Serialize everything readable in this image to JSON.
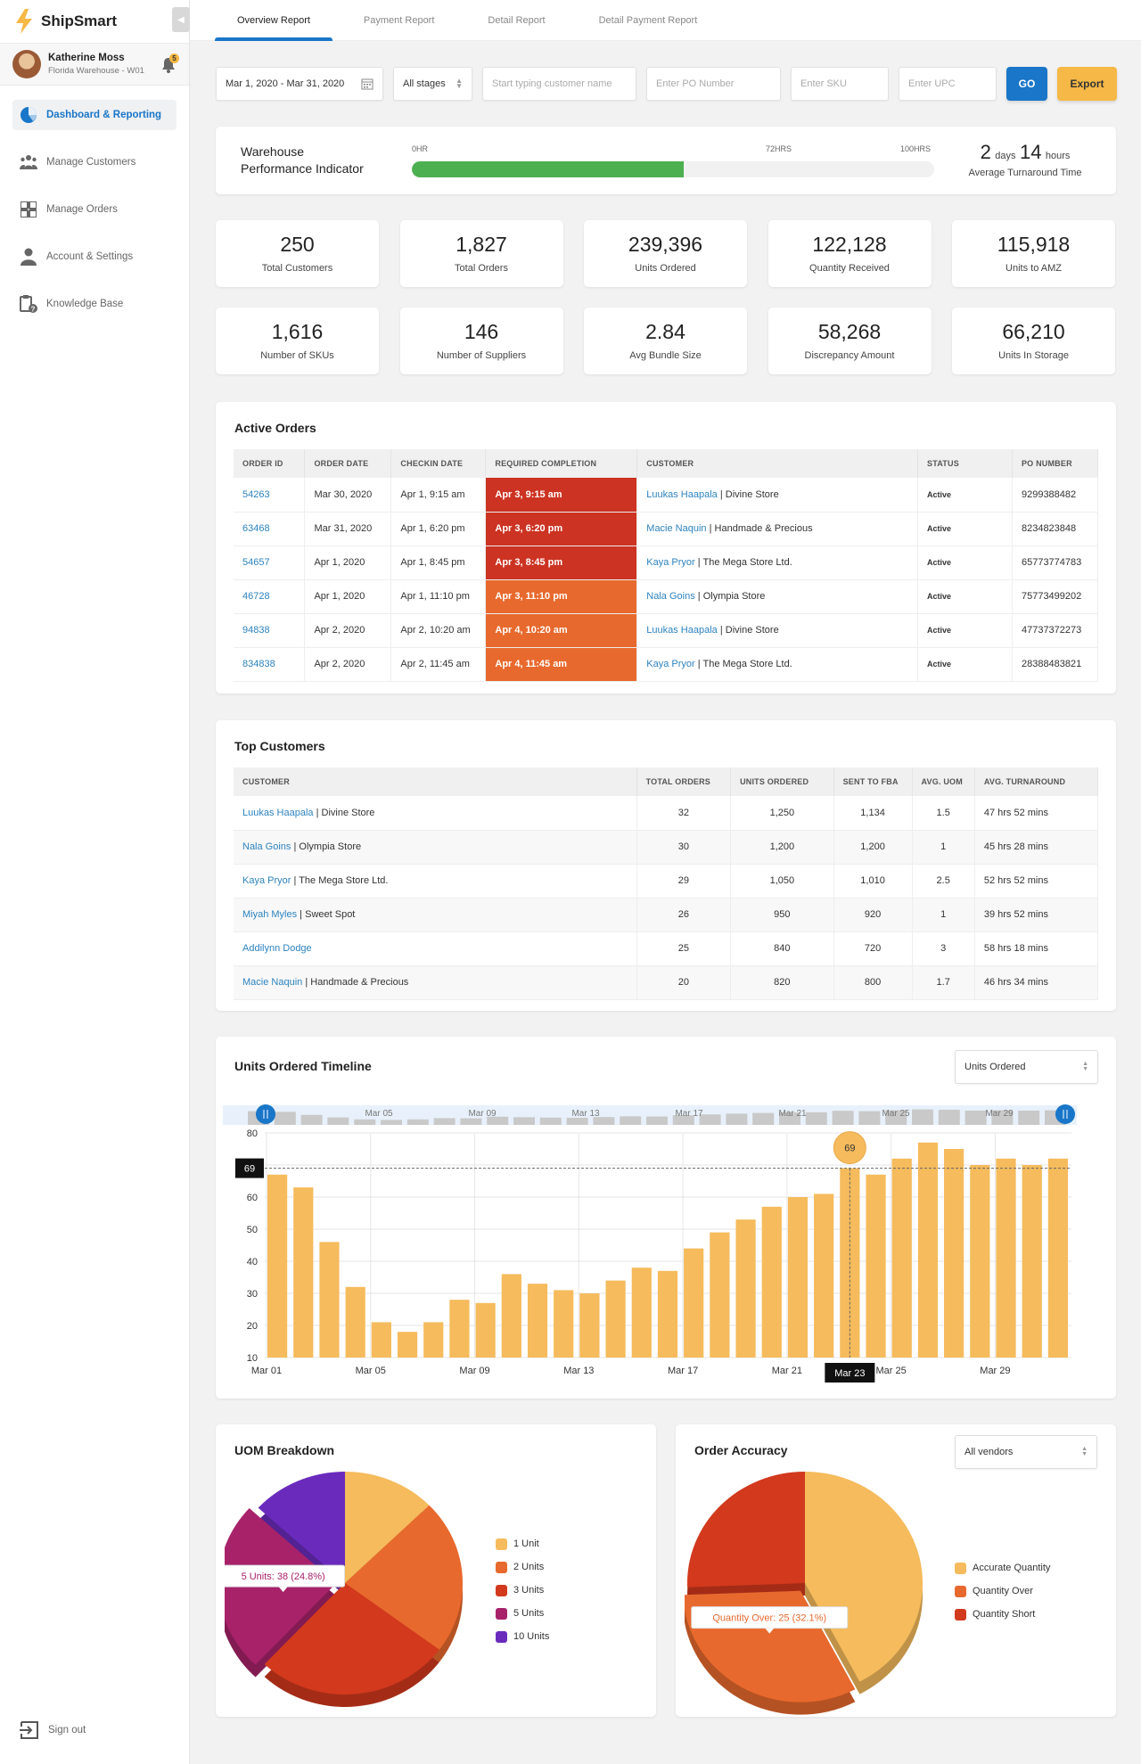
{
  "app": {
    "name": "ShipSmart"
  },
  "user": {
    "name": "Katherine Moss",
    "location": "Florida Warehouse - W01",
    "notifications": "5"
  },
  "sidebar": {
    "items": [
      {
        "label": "Dashboard & Reporting",
        "icon": "pie-chart-icon",
        "active": true
      },
      {
        "label": "Manage Customers",
        "icon": "users-icon"
      },
      {
        "label": "Manage Orders",
        "icon": "grid-icon"
      },
      {
        "label": "Account & Settings",
        "icon": "user-icon"
      },
      {
        "label": "Knowledge Base",
        "icon": "clipboard-help-icon"
      }
    ],
    "signout": "Sign out"
  },
  "tabs": [
    {
      "label": "Overview Report",
      "active": true
    },
    {
      "label": "Payment Report"
    },
    {
      "label": "Detail Report"
    },
    {
      "label": "Detail Payment Report"
    }
  ],
  "filters": {
    "date_range": "Mar 1, 2020 - Mar 31, 2020",
    "stage": "All stages",
    "customer_placeholder": "Start typing customer name",
    "po_placeholder": "Enter PO Number",
    "sku_placeholder": "Enter SKU",
    "upc_placeholder": "Enter UPC",
    "go": "GO",
    "export": "Export"
  },
  "wpi": {
    "title_line1": "Warehouse",
    "title_line2": "Performance Indicator",
    "label_start": "0HR",
    "label_mid": "72HRS",
    "label_end": "100HRS",
    "progress_percent": 52,
    "days": "2",
    "days_unit": "days",
    "hours": "14",
    "hours_unit": "hours",
    "subtitle": "Average Turnaround Time"
  },
  "stats": [
    {
      "value": "250",
      "label": "Total Customers"
    },
    {
      "value": "1,827",
      "label": "Total Orders"
    },
    {
      "value": "239,396",
      "label": "Units Ordered"
    },
    {
      "value": "122,128",
      "label": "Quantity Received"
    },
    {
      "value": "115,918",
      "label": "Units to AMZ"
    },
    {
      "value": "1,616",
      "label": "Number of SKUs"
    },
    {
      "value": "146",
      "label": "Number of Suppliers"
    },
    {
      "value": "2.84",
      "label": "Avg Bundle Size"
    },
    {
      "value": "58,268",
      "label": "Discrepancy Amount"
    },
    {
      "value": "66,210",
      "label": "Units In Storage"
    }
  ],
  "active_orders": {
    "title": "Active Orders",
    "columns": [
      "ORDER ID",
      "ORDER DATE",
      "CHECKIN DATE",
      "REQUIRED COMPLETION",
      "CUSTOMER",
      "STATUS",
      "PO NUMBER"
    ],
    "rows": [
      {
        "id": "54263",
        "order_date": "Mar 30, 2020",
        "checkin": "Apr 1, 9:15 am",
        "required": "Apr 3, 9:15 am",
        "urgency": "red",
        "customer": "Luukas Haapala",
        "store": "Divine Store",
        "status": "Active",
        "po": "9299388482"
      },
      {
        "id": "63468",
        "order_date": "Mar 31, 2020",
        "checkin": "Apr 1, 6:20 pm",
        "required": "Apr 3, 6:20 pm",
        "urgency": "red",
        "customer": "Macie Naquin",
        "store": "Handmade & Precious",
        "status": "Active",
        "po": "8234823848"
      },
      {
        "id": "54657",
        "order_date": "Apr 1, 2020",
        "checkin": "Apr 1, 8:45 pm",
        "required": "Apr 3, 8:45 pm",
        "urgency": "red",
        "customer": "Kaya Pryor",
        "store": "The Mega Store Ltd.",
        "status": "Active",
        "po": "65773774783"
      },
      {
        "id": "46728",
        "order_date": "Apr 1, 2020",
        "checkin": "Apr 1, 11:10 pm",
        "required": "Apr 3, 11:10 pm",
        "urgency": "orange",
        "customer": "Nala Goins",
        "store": "Olympia Store",
        "status": "Active",
        "po": "75773499202"
      },
      {
        "id": "94838",
        "order_date": "Apr 2, 2020",
        "checkin": "Apr 2, 10:20 am",
        "required": "Apr 4, 10:20 am",
        "urgency": "orange",
        "customer": "Luukas Haapala",
        "store": "Divine Store",
        "status": "Active",
        "po": "47737372273"
      },
      {
        "id": "834838",
        "order_date": "Apr 2, 2020",
        "checkin": "Apr 2, 11:45 am",
        "required": "Apr 4, 11:45 am",
        "urgency": "orange",
        "customer": "Kaya Pryor",
        "store": "The Mega Store Ltd.",
        "status": "Active",
        "po": "28388483821"
      }
    ]
  },
  "top_customers": {
    "title": "Top Customers",
    "columns": [
      "CUSTOMER",
      "TOTAL ORDERS",
      "UNITS ORDERED",
      "SENT TO FBA",
      "AVG. UOM",
      "AVG. TURNAROUND"
    ],
    "rows": [
      {
        "customer": "Luukas Haapala",
        "store": "Divine Store",
        "orders": "32",
        "units": "1,250",
        "fba": "1,134",
        "uom": "1.5",
        "turnaround": "47 hrs 52 mins"
      },
      {
        "customer": "Nala Goins",
        "store": "Olympia Store",
        "orders": "30",
        "units": "1,200",
        "fba": "1,200",
        "uom": "1",
        "turnaround": "45 hrs 28 mins"
      },
      {
        "customer": "Kaya Pryor",
        "store": "The Mega Store Ltd.",
        "orders": "29",
        "units": "1,050",
        "fba": "1,010",
        "uom": "2.5",
        "turnaround": "52 hrs 52 mins"
      },
      {
        "customer": "Miyah Myles",
        "store": "Sweet Spot",
        "orders": "26",
        "units": "950",
        "fba": "920",
        "uom": "1",
        "turnaround": "39 hrs 52 mins"
      },
      {
        "customer": "Addilynn Dodge",
        "store": "",
        "orders": "25",
        "units": "840",
        "fba": "720",
        "uom": "3",
        "turnaround": "58 hrs 18 mins"
      },
      {
        "customer": "Macie Naquin",
        "store": "Handmade & Precious",
        "orders": "20",
        "units": "820",
        "fba": "800",
        "uom": "1.7",
        "turnaround": "46 hrs 34 mins"
      }
    ]
  },
  "timeline": {
    "title": "Units Ordered Timeline",
    "metric_select": "Units Ordered",
    "navigator_labels": [
      "Mar 05",
      "Mar 09",
      "Mar 13",
      "Mar 17",
      "Mar 21",
      "Mar 25",
      "Mar 29"
    ],
    "tooltip_value": "69",
    "tooltip_date": "Mar 23"
  },
  "uom": {
    "title": "UOM Breakdown",
    "tooltip": "5 Units: 38 (24.8%)"
  },
  "accuracy": {
    "title": "Order Accuracy",
    "vendor_select": "All vendors",
    "tooltip": "Quantity Over: 25 (32.1%)"
  },
  "colors": {
    "primary": "#1976c8",
    "accent": "#f6b846",
    "bar": "#f5bb5c",
    "urgent_red": "#cc3322",
    "urgent_orange": "#e8692d",
    "progress": "#4caf50"
  },
  "chart_data": [
    {
      "type": "bar",
      "title": "Units Ordered Timeline",
      "xlabel": "",
      "ylabel": "",
      "ylim": [
        10,
        80
      ],
      "yticks": [
        10,
        20,
        30,
        40,
        50,
        60,
        70,
        80
      ],
      "ytick_labels": [
        "10",
        "20",
        "30",
        "40",
        "50",
        "60",
        "",
        "80"
      ],
      "xtick_labels": [
        "Mar 01",
        "Mar 05",
        "Mar 09",
        "Mar 13",
        "Mar 17",
        "Mar 21",
        "Mar 25",
        "Mar 29"
      ],
      "categories": [
        "Mar 01",
        "Mar 02",
        "Mar 03",
        "Mar 04",
        "Mar 05",
        "Mar 06",
        "Mar 07",
        "Mar 08",
        "Mar 09",
        "Mar 10",
        "Mar 11",
        "Mar 12",
        "Mar 13",
        "Mar 14",
        "Mar 15",
        "Mar 16",
        "Mar 17",
        "Mar 18",
        "Mar 19",
        "Mar 20",
        "Mar 21",
        "Mar 22",
        "Mar 23",
        "Mar 24",
        "Mar 25",
        "Mar 26",
        "Mar 27",
        "Mar 28",
        "Mar 29",
        "Mar 30",
        "Mar 31"
      ],
      "values": [
        67,
        63,
        46,
        32,
        21,
        18,
        21,
        28,
        27,
        36,
        33,
        31,
        30,
        34,
        38,
        37,
        44,
        49,
        53,
        57,
        60,
        61,
        69,
        67,
        72,
        77,
        75,
        70,
        72,
        70,
        72
      ],
      "grid": true,
      "highlight": {
        "category": "Mar 23",
        "value": 69
      }
    },
    {
      "type": "pie",
      "title": "UOM Breakdown",
      "legend": "right",
      "categories": [
        "1 Unit",
        "2 Units",
        "3 Units",
        "5 Units",
        "10 Units"
      ],
      "values": [
        12.7,
        22.5,
        26.8,
        24.8,
        13.2
      ],
      "colors": [
        "#f5bb5c",
        "#e8692d",
        "#d2391d",
        "#a8226a",
        "#6a2bbd"
      ],
      "annotation": "5 Units: 38 (24.8%)"
    },
    {
      "type": "pie",
      "title": "Order Accuracy",
      "legend": "right",
      "categories": [
        "Accurate Quantity",
        "Quantity Over",
        "Quantity Short"
      ],
      "values": [
        42.3,
        32.1,
        25.6
      ],
      "colors": [
        "#f5bb5c",
        "#e8692d",
        "#d2391d"
      ],
      "annotation": "Quantity Over: 25 (32.1%)"
    }
  ]
}
